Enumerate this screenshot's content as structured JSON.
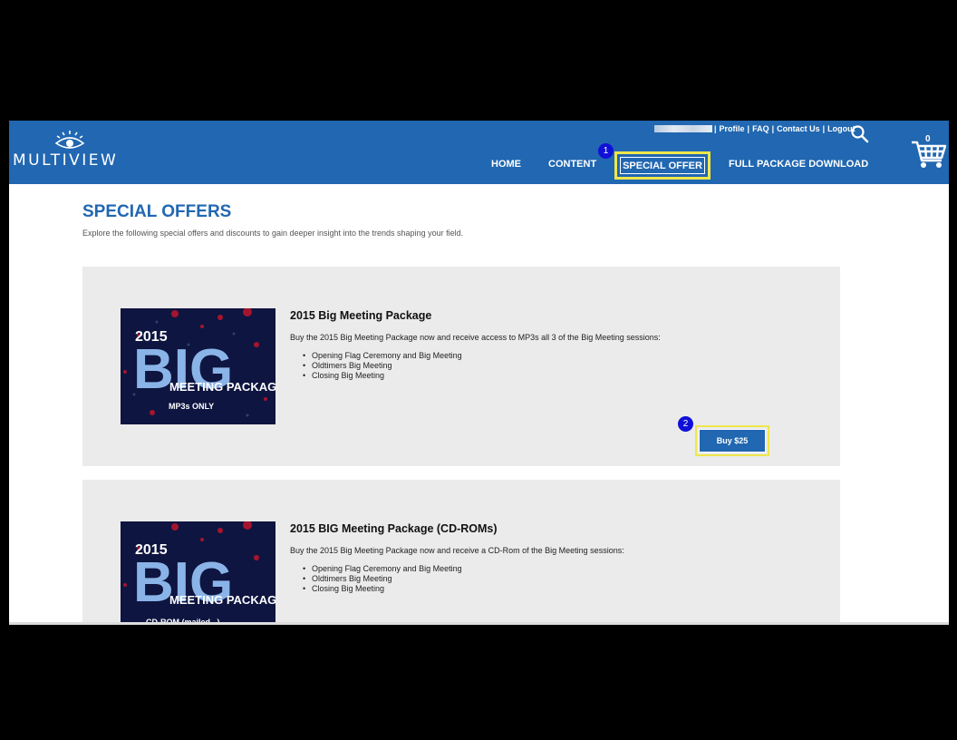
{
  "header": {
    "logo_text": "MULTIVIEW",
    "util_links": [
      "Profile",
      "FAQ",
      "Contact Us",
      "Logout"
    ],
    "cart_count": "0",
    "nav": {
      "home": "HOME",
      "content": "CONTENT",
      "special_offer": "SPECIAL OFFER",
      "full_package": "FULL PACKAGE DOWNLOAD"
    },
    "brand_color": "#2167b1",
    "highlight_color": "#efe64a"
  },
  "markers": {
    "one": "1",
    "two": "2"
  },
  "main": {
    "title": "SPECIAL OFFERS",
    "subtitle": "Explore the following special offers and discounts to gain deeper insight into the trends shaping your field."
  },
  "offers": [
    {
      "title": "2015 Big Meeting Package",
      "description": "Buy the 2015 Big Meeting Package now and receive access to MP3s all 3 of the Big Meeting sessions:",
      "items": [
        "Opening Flag Ceremony and Big Meeting",
        "Oldtimers Big Meeting",
        "Closing Big Meeting"
      ],
      "thumb_year": "2015",
      "thumb_big": "BIG",
      "thumb_package": "MEETING PACKAGE",
      "thumb_caption": "MP3s ONLY",
      "buy_label": "Buy $25"
    },
    {
      "title": "2015 BIG Meeting Package (CD-ROMs)",
      "description": "Buy the 2015 Big Meeting Package now and receive a CD-Rom of the Big Meeting sessions:",
      "items": [
        "Opening Flag Ceremony and Big Meeting",
        "Oldtimers Big Meeting",
        "Closing Big Meeting"
      ],
      "thumb_year": "2015",
      "thumb_big": "BIG",
      "thumb_package": "MEETING PACKAGE",
      "thumb_caption": "CD-ROM (mailed...)"
    }
  ]
}
